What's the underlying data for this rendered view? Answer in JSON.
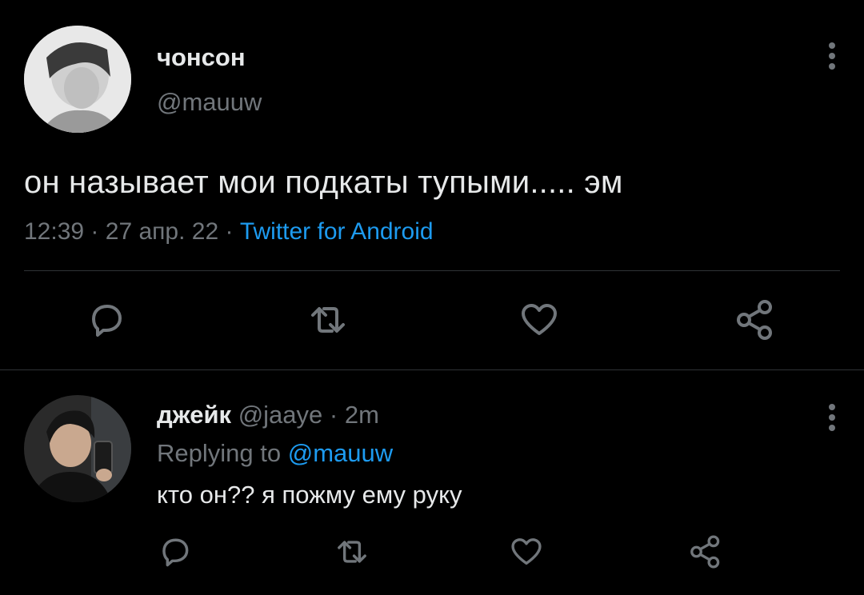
{
  "main_tweet": {
    "author_name": "чонсон",
    "author_handle": "@mauuw",
    "text": "он называет мои подкаты тупыми..... эм",
    "time": "12:39",
    "date": "27 апр. 22",
    "source": "Twitter for Android",
    "separator": "·",
    "actions": [
      "reply-icon",
      "retweet-icon",
      "like-icon",
      "share-icon"
    ]
  },
  "reply": {
    "author_name": "джейк",
    "author_handle": "@jaaye",
    "separator": "·",
    "time": "2m",
    "replying_prefix": "Replying to",
    "replying_to": "@mauuw",
    "text": "кто он?? я пожму ему руку",
    "actions": [
      "reply-icon",
      "retweet-icon",
      "like-icon",
      "share-icon"
    ]
  },
  "colors": {
    "background": "#000000",
    "text_primary": "#e7e9ea",
    "text_secondary": "#71767b",
    "accent": "#1d9bf0",
    "divider": "#2f3336"
  }
}
